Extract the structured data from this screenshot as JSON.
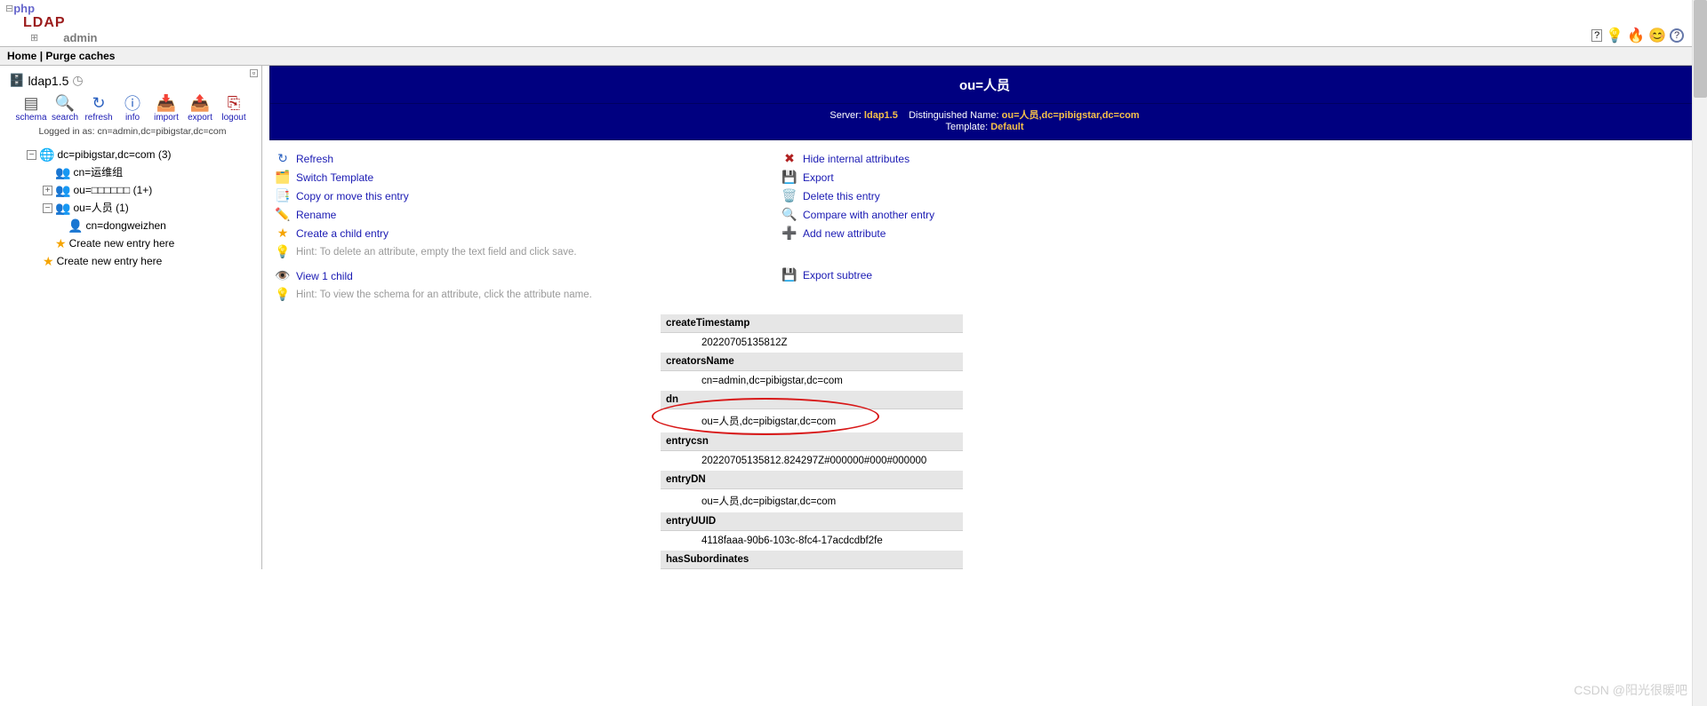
{
  "app": {
    "logo_php": "php",
    "logo_ldap": "LDAP",
    "logo_admin": "admin"
  },
  "top_icons": {
    "help": "❏?",
    "bulb": "💡",
    "bug": "🐞",
    "smile": "😊",
    "qmark": "?"
  },
  "topbar": {
    "home": "Home",
    "sep": "|",
    "purge": "Purge caches"
  },
  "sidebar": {
    "server_name": "ldap1.5",
    "toolbar": {
      "schema": "schema",
      "search": "search",
      "refresh": "refresh",
      "info": "info",
      "import": "import",
      "export": "export",
      "logout": "logout"
    },
    "logged_in": "Logged in as: cn=admin,dc=pibigstar,dc=com",
    "tree": {
      "root": "dc=pibigstar,dc=com (3)",
      "ou1": "cn=运维组",
      "ou2": "ou=□□□□□□ (1+)",
      "ou3": "ou=人员 (1)",
      "leaf1": "cn=dongweizhen",
      "create1": "Create new entry here",
      "create2": "Create new entry here"
    }
  },
  "main": {
    "title": "ou=人员",
    "info": {
      "server_label": "Server:",
      "server": "ldap1.5",
      "dn_label": "Distinguished Name:",
      "dn": "ou=人员,dc=pibigstar,dc=com",
      "tpl_label": "Template:",
      "tpl": "Default"
    },
    "left_actions": {
      "refresh": "Refresh",
      "switch_template": "Switch Template",
      "copy_move": "Copy or move this entry",
      "rename": "Rename",
      "create_child": "Create a child entry",
      "hint1": "Hint: To delete an attribute, empty the text field and click save.",
      "view_child": "View 1 child",
      "hint2": "Hint: To view the schema for an attribute, click the attribute name."
    },
    "right_actions": {
      "hide_internal": "Hide internal attributes",
      "export": "Export",
      "delete": "Delete this entry",
      "compare": "Compare with another entry",
      "add_attr": "Add new attribute",
      "export_subtree": "Export subtree"
    },
    "attrs": [
      {
        "name": "createTimestamp",
        "value": "20220705135812Z"
      },
      {
        "name": "creatorsName",
        "value": "cn=admin,dc=pibigstar,dc=com"
      },
      {
        "name": "dn",
        "value": "ou=人员,dc=pibigstar,dc=com"
      },
      {
        "name": "entrycsn",
        "value": "20220705135812.824297Z#000000#000#000000"
      },
      {
        "name": "entryDN",
        "value": "ou=人员,dc=pibigstar,dc=com"
      },
      {
        "name": "entryUUID",
        "value": "4118faaa-90b6-103c-8fc4-17acdcdbf2fe"
      },
      {
        "name": "hasSubordinates",
        "value": ""
      }
    ]
  },
  "watermark": "CSDN @阳光很暖吧"
}
